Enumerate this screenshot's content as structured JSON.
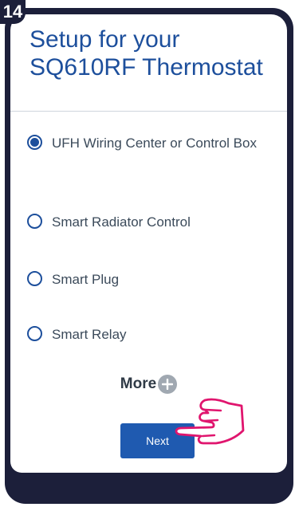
{
  "step": "14",
  "header": {
    "title": "Setup for your SQ610RF Thermostat"
  },
  "options": [
    {
      "label": "UFH Wiring Center or Control Box",
      "selected": true
    },
    {
      "label": "Smart Radiator Control",
      "selected": false
    },
    {
      "label": "Smart Plug",
      "selected": false
    },
    {
      "label": "Smart Relay",
      "selected": false
    }
  ],
  "more": {
    "label": "More"
  },
  "next": {
    "label": "Next"
  },
  "colors": {
    "primary": "#1f5ab0",
    "title": "#1d4f9c",
    "frame": "#1c1f3a",
    "pointer": "#e0156e"
  },
  "icons": {
    "more": "plus-circle-icon",
    "pointer": "pointing-hand-icon"
  }
}
